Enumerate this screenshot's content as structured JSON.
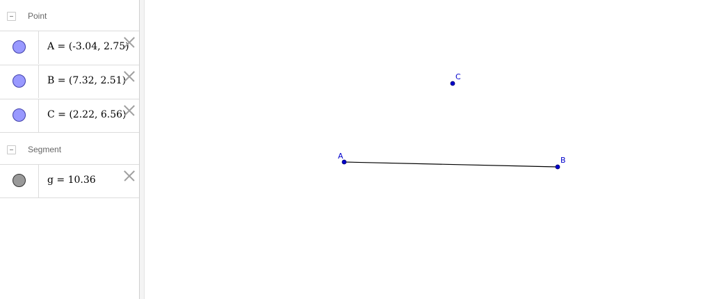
{
  "algebra_view": {
    "groups": [
      {
        "label": "Point",
        "items": [
          {
            "text": "A = (-3.04, 2.75)",
            "type": "point"
          },
          {
            "text": "B = (7.32, 2.51)",
            "type": "point"
          },
          {
            "text": "C = (2.22, 6.56)",
            "type": "point"
          }
        ]
      },
      {
        "label": "Segment",
        "items": [
          {
            "text": "g = 10.36",
            "type": "segment"
          }
        ]
      }
    ],
    "colors": {
      "point_fill": "#9999ff",
      "point_stroke": "#3f3fa8",
      "segment_fill": "#999999",
      "segment_stroke": "#333333"
    }
  },
  "graphics_view": {
    "points": [
      {
        "label": "A"
      },
      {
        "label": "B"
      },
      {
        "label": "C"
      }
    ],
    "segment": {
      "name": "g",
      "from": "A",
      "to": "B",
      "color": "#000000"
    },
    "point_color": "#0000cc"
  }
}
